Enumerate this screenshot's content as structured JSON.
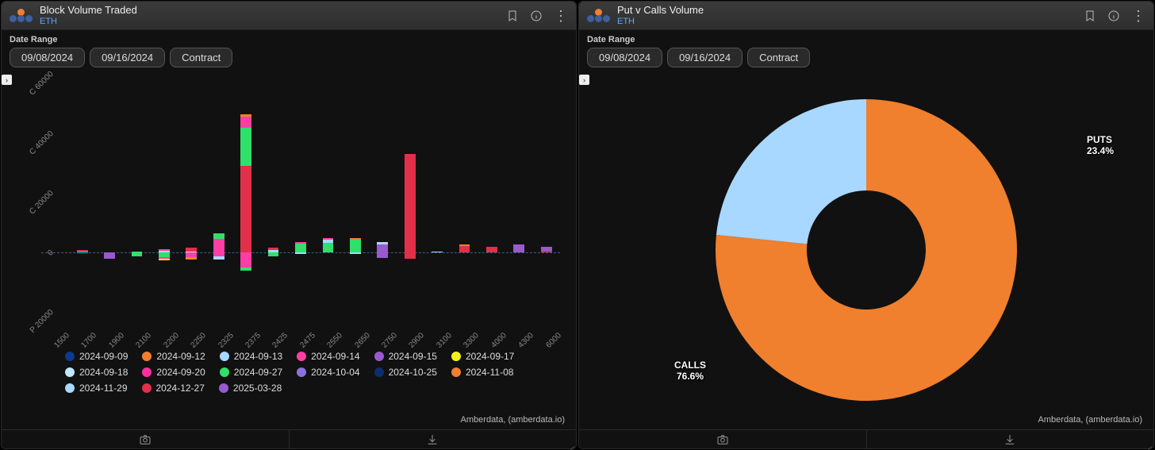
{
  "left": {
    "title": "Block Volume Traded",
    "subtitle": "ETH",
    "date_range_label": "Date Range",
    "date_from": "09/08/2024",
    "date_to": "09/16/2024",
    "contract_btn": "Contract",
    "attribution": "Amberdata, (amberdata.io)"
  },
  "right": {
    "title": "Put v Calls Volume",
    "subtitle": "ETH",
    "date_range_label": "Date Range",
    "date_from": "09/08/2024",
    "date_to": "09/16/2024",
    "contract_btn": "Contract",
    "attribution": "Amberdata, (amberdata.io)",
    "label_puts_name": "PUTS",
    "label_puts_pct": "23.4%",
    "label_calls_name": "CALLS",
    "label_calls_pct": "76.6%"
  },
  "chart_data": [
    {
      "type": "bar",
      "title": "Block Volume Traded",
      "ylabel": "",
      "ylim": [
        -20000,
        60000
      ],
      "y_ticks": [
        "P 20000",
        "0",
        "C 20000",
        "C 40000",
        "C 60000"
      ],
      "categories": [
        "1500",
        "1700",
        "1900",
        "2100",
        "2200",
        "2250",
        "2325",
        "2375",
        "2425",
        "2475",
        "2550",
        "2650",
        "2750",
        "2900",
        "3100",
        "3300",
        "4000",
        "4300",
        "6000"
      ],
      "legend": [
        {
          "name": "2024-09-09",
          "color": "#0b3a8f"
        },
        {
          "name": "2024-09-12",
          "color": "#f07f2e"
        },
        {
          "name": "2024-09-13",
          "color": "#a8d8ff"
        },
        {
          "name": "2024-09-14",
          "color": "#ff3ea5"
        },
        {
          "name": "2024-09-15",
          "color": "#9b59d0"
        },
        {
          "name": "2024-09-17",
          "color": "#f4f01a"
        },
        {
          "name": "2024-09-18",
          "color": "#bfe7ff"
        },
        {
          "name": "2024-09-20",
          "color": "#ff2fa0"
        },
        {
          "name": "2024-09-27",
          "color": "#2fe06a"
        },
        {
          "name": "2024-10-04",
          "color": "#8e6fe0"
        },
        {
          "name": "2024-10-25",
          "color": "#0b2e6e"
        },
        {
          "name": "2024-11-08",
          "color": "#f07f2e"
        },
        {
          "name": "2024-11-29",
          "color": "#a8d8ff"
        },
        {
          "name": "2024-12-27",
          "color": "#e22f4a"
        },
        {
          "name": "2025-03-28",
          "color": "#9b59d0"
        }
      ],
      "stacks": {
        "1500": {
          "pos": [],
          "neg": []
        },
        "1700": {
          "pos": [
            {
              "c": "#2fe06a",
              "v": 400
            },
            {
              "c": "#e22f4a",
              "v": 300
            }
          ],
          "neg": [
            {
              "c": "#0b3a8f",
              "v": 500
            }
          ]
        },
        "1900": {
          "pos": [],
          "neg": [
            {
              "c": "#9b59d0",
              "v": 2200
            }
          ]
        },
        "2100": {
          "pos": [
            {
              "c": "#2fe06a",
              "v": 400
            }
          ],
          "neg": [
            {
              "c": "#2fe06a",
              "v": 1200
            }
          ]
        },
        "2200": {
          "pos": [
            {
              "c": "#a8d8ff",
              "v": 500
            },
            {
              "c": "#ff3ea5",
              "v": 600
            }
          ],
          "neg": [
            {
              "c": "#2fe06a",
              "v": 1500
            },
            {
              "c": "#ff3ea5",
              "v": 700
            },
            {
              "c": "#f4f01a",
              "v": 400
            }
          ]
        },
        "2250": {
          "pos": [
            {
              "c": "#bfe7ff",
              "v": 400
            },
            {
              "c": "#e22f4a",
              "v": 1200
            }
          ],
          "neg": [
            {
              "c": "#ff3ea5",
              "v": 1600
            },
            {
              "c": "#f07f2e",
              "v": 700
            }
          ]
        },
        "2325": {
          "pos": [
            {
              "c": "#ff3ea5",
              "v": 4500
            },
            {
              "c": "#2fe06a",
              "v": 1800
            }
          ],
          "neg": [
            {
              "c": "#ff3ea5",
              "v": 1400
            },
            {
              "c": "#a8d8ff",
              "v": 900
            }
          ]
        },
        "2375": {
          "pos": [
            {
              "c": "#e22f4a",
              "v": 29000
            },
            {
              "c": "#2fe06a",
              "v": 13000
            },
            {
              "c": "#ff3ea5",
              "v": 3500
            },
            {
              "c": "#f07f2e",
              "v": 1000
            }
          ],
          "neg": [
            {
              "c": "#ff3ea5",
              "v": 5000
            },
            {
              "c": "#2fe06a",
              "v": 1000
            }
          ]
        },
        "2425": {
          "pos": [
            {
              "c": "#a8d8ff",
              "v": 800
            },
            {
              "c": "#e22f4a",
              "v": 800
            }
          ],
          "neg": [
            {
              "c": "#2fe06a",
              "v": 1400
            }
          ]
        },
        "2475": {
          "pos": [
            {
              "c": "#2fe06a",
              "v": 3000
            },
            {
              "c": "#ff3ea5",
              "v": 600
            }
          ],
          "neg": [
            {
              "c": "#a8d8ff",
              "v": 400
            }
          ]
        },
        "2550": {
          "pos": [
            {
              "c": "#2fe06a",
              "v": 3200
            },
            {
              "c": "#a8d8ff",
              "v": 1000
            },
            {
              "c": "#ff3ea5",
              "v": 500
            }
          ],
          "neg": []
        },
        "2650": {
          "pos": [
            {
              "c": "#2fe06a",
              "v": 4200
            },
            {
              "c": "#f07f2e",
              "v": 700
            }
          ],
          "neg": [
            {
              "c": "#a8d8ff",
              "v": 400
            }
          ]
        },
        "2750": {
          "pos": [
            {
              "c": "#9b59d0",
              "v": 2800
            },
            {
              "c": "#a8d8ff",
              "v": 600
            }
          ],
          "neg": [
            {
              "c": "#9b59d0",
              "v": 1800
            }
          ]
        },
        "2900": {
          "pos": [
            {
              "c": "#e22f4a",
              "v": 33000
            }
          ],
          "neg": [
            {
              "c": "#e22f4a",
              "v": 2200
            }
          ]
        },
        "3100": {
          "pos": [
            {
              "c": "#a8d8ff",
              "v": 300
            }
          ],
          "neg": []
        },
        "3300": {
          "pos": [
            {
              "c": "#e22f4a",
              "v": 2200
            },
            {
              "c": "#f07f2e",
              "v": 400
            }
          ],
          "neg": []
        },
        "4000": {
          "pos": [
            {
              "c": "#e22f4a",
              "v": 1800
            }
          ],
          "neg": []
        },
        "4300": {
          "pos": [
            {
              "c": "#9b59d0",
              "v": 2800
            }
          ],
          "neg": []
        },
        "6000": {
          "pos": [
            {
              "c": "#e22f4a",
              "v": 600
            },
            {
              "c": "#9b59d0",
              "v": 1300
            }
          ],
          "neg": []
        }
      }
    },
    {
      "type": "pie",
      "title": "Put v Calls Volume",
      "data": [
        {
          "name": "CALLS",
          "value": 76.6,
          "color": "#f07f2e"
        },
        {
          "name": "PUTS",
          "value": 23.4,
          "color": "#a8d8ff"
        }
      ]
    }
  ]
}
